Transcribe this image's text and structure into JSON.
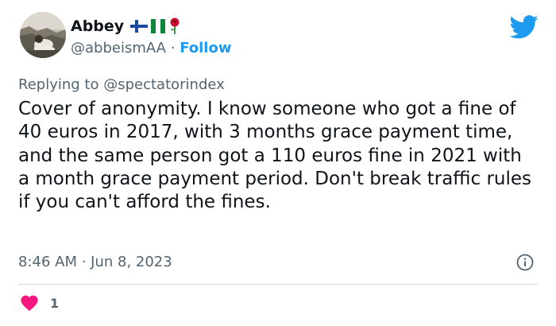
{
  "author": {
    "name": "Abbey",
    "flags": [
      "finland-flag-icon",
      "nigeria-flag-icon",
      "rose-icon"
    ],
    "handle": "@abbeismAA",
    "separator": "·",
    "follow_label": "Follow"
  },
  "reply": {
    "prefix": "Replying to",
    "target": "@spectatorindex"
  },
  "tweet_text": "Cover of anonymity. I know someone who got a fine of 40 euros in 2017, with 3 months grace payment time, and the same person got a 110 euros fine in 2021 with a month grace payment period. Don't break traffic rules if you can't afford the fines.",
  "timestamp": "8:46 AM · Jun 8, 2023",
  "likes": {
    "count": "1"
  },
  "colors": {
    "accent": "#1d9bf0",
    "secondary_text": "#536471",
    "heart": "#f91880",
    "divider": "#cfd9de"
  }
}
